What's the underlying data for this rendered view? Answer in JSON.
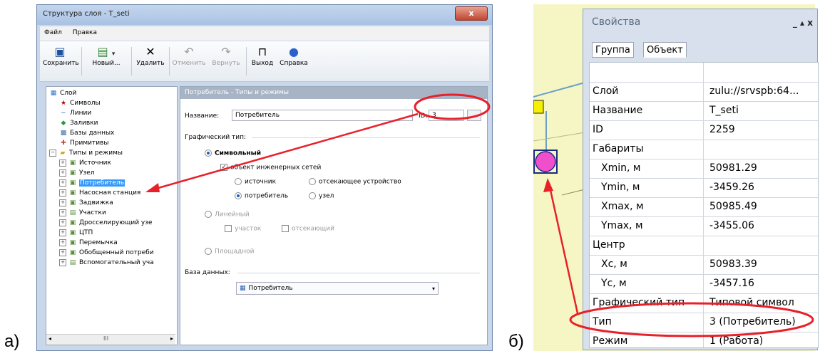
{
  "labels": {
    "a": "а)",
    "b": "б)"
  },
  "window_a": {
    "title": "Структура слоя - T_seti",
    "close": "x",
    "menu": [
      "Файл",
      "Правка"
    ],
    "toolbar": [
      {
        "label": "Сохранить",
        "icon": "save-icon",
        "enabled": true
      },
      {
        "label": "Новый...",
        "icon": "new-icon",
        "enabled": true
      },
      {
        "label": "Удалить",
        "icon": "delete-icon",
        "enabled": true
      },
      {
        "label": "Отменить",
        "icon": "undo-icon",
        "enabled": false
      },
      {
        "label": "Вернуть",
        "icon": "redo-icon",
        "enabled": false
      },
      {
        "label": "Выход",
        "icon": "exit-icon",
        "enabled": true
      },
      {
        "label": "Справка",
        "icon": "help-icon",
        "enabled": true
      }
    ],
    "tree": {
      "root": "Слой",
      "children": [
        "Символы",
        "Линии",
        "Заливки",
        "Базы данных",
        "Примитивы"
      ],
      "types_folder": "Типы и режимы",
      "types": [
        "Источник",
        "Узел",
        "Потребитель",
        "Насосная станция",
        "Задвижка",
        "Участки",
        "Дросселирующий узе",
        "ЦТП",
        "Перемычка",
        "Обобщенный потреби",
        "Вспомогательный уча"
      ],
      "selected": "Потребитель",
      "scroll_label": "III"
    },
    "panel": {
      "header": "Потребитель - Типы и режимы",
      "name_label": "Название:",
      "name_value": "Потребитель",
      "id_label": "ID:",
      "id_value": "3",
      "id_button": "...",
      "graphic_type_label": "Графический тип:",
      "symbolic": "Символьный",
      "engineering_object": "объект инженерных сетей",
      "opt_source": "источник",
      "opt_shutoff": "отсекающее устройство",
      "opt_consumer": "потребитель",
      "opt_node": "узел",
      "linear": "Линейный",
      "opt_section": "участок",
      "opt_cutting": "отсекающий",
      "areal": "Площадной",
      "database_label": "База данных:",
      "database_value": "Потребитель"
    }
  },
  "window_b": {
    "title": "Свойства",
    "controls": "_ ▴ x",
    "tabs": [
      "Группа",
      "Объект"
    ],
    "rows": [
      {
        "name": "",
        "value": "",
        "sub": false
      },
      {
        "name": "Слой",
        "value": "zulu://srvspb:64...",
        "sub": false
      },
      {
        "name": "Название",
        "value": "T_seti",
        "sub": false
      },
      {
        "name": "ID",
        "value": "2259",
        "sub": false
      },
      {
        "name": "Габариты",
        "value": "",
        "sub": false
      },
      {
        "name": "Xmin, м",
        "value": "50981.29",
        "sub": true
      },
      {
        "name": "Ymin, м",
        "value": "-3459.26",
        "sub": true
      },
      {
        "name": "Xmax, м",
        "value": "50985.49",
        "sub": true
      },
      {
        "name": "Ymax, м",
        "value": "-3455.06",
        "sub": true
      },
      {
        "name": "Центр",
        "value": "",
        "sub": false
      },
      {
        "name": "Xc, м",
        "value": "50983.39",
        "sub": true
      },
      {
        "name": "Yc, м",
        "value": "-3457.16",
        "sub": true
      },
      {
        "name": "Графический тип",
        "value": "Типовой символ",
        "sub": false
      },
      {
        "name": "Тип",
        "value": "3 (Потребитель)",
        "sub": false
      },
      {
        "name": "Режим",
        "value": "1 (Работа)",
        "sub": false
      }
    ]
  },
  "colors": {
    "annotation": "#e8202a",
    "consumer_symbol": "#f04ecb",
    "node_symbol": "#f5ef00",
    "selection": "#3399ff"
  }
}
